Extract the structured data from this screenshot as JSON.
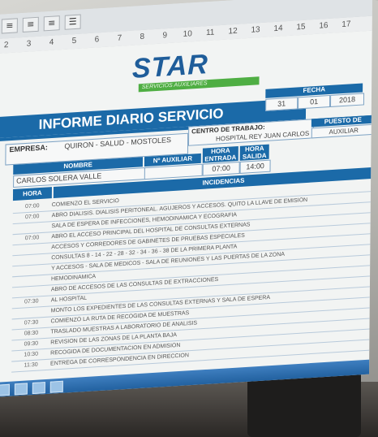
{
  "toolbar": {
    "icons": [
      "align-left-icon",
      "align-center-icon",
      "align-right-icon",
      "list-icon"
    ]
  },
  "ruler": [
    "2",
    "3",
    "4",
    "5",
    "6",
    "7",
    "8",
    "9",
    "10",
    "11",
    "12",
    "13",
    "14",
    "15",
    "16",
    "17"
  ],
  "logo": {
    "name": "STAR",
    "subtitle": "SERVICIOS AUXILIARES"
  },
  "report": {
    "title": "INFORME DIARIO SERVICIO",
    "fecha_label": "FECHA",
    "fecha": [
      "31",
      "01",
      "2018"
    ],
    "empresa_label": "EMPRESA:",
    "empresa": "QUIRON - SALUD - MOSTOLES",
    "centro_label": "CENTRO DE TRABAJO:",
    "centro": "HOSPITAL REY JUAN CARLOS",
    "puesto_label": "PUESTO DE TRABAJO",
    "puesto": "AUXILIAR",
    "nombre_label": "NOMBRE",
    "nauxiliar_label": "Nº AUXILIAR",
    "entrada_label": "HORA ENTRADA",
    "salida_label": "HORA SALIDA",
    "nombre": "CARLOS SOLERA VALLE",
    "entrada": "07:00",
    "salida": "14:00",
    "hora_label": "HORA",
    "incidencias_label": "INCIDENCIAS",
    "rows": [
      {
        "time": "07:00",
        "text": "COMIENZO EL SERVICIO"
      },
      {
        "time": "07:00",
        "text": "ABRO DIALISIS. DIALISIS PERITONEAL. AGUJEROS Y ACCESOS. QUITO LA LLAVE DE EMISION"
      },
      {
        "time": "",
        "text": "SALA DE ESPERA DE INFECCIONES, HEMODINAMICA Y ECOGRAFIA"
      },
      {
        "time": "07:00",
        "text": "ABRO EL ACCESO PRINCIPAL DEL HOSPITAL DE CONSULTAS EXTERNAS"
      },
      {
        "time": "",
        "text": "ACCESOS Y CORREDORES DE GABINETES DE PRUEBAS ESPECIALES"
      },
      {
        "time": "",
        "text": "CONSULTAS 8 - 14 - 22 - 28 - 32 - 34 - 36 - 38 DE LA PRIMERA PLANTA"
      },
      {
        "time": "",
        "text": "Y ACCESOS - SALA DE MEDICOS - SALA DE REUNIONES Y LAS PUERTAS DE LA ZONA"
      },
      {
        "time": "",
        "text": "HEMODINAMICA"
      },
      {
        "time": "",
        "text": "ABRO DE ACCESOS DE LAS CONSULTAS DE EXTRACCIONES"
      },
      {
        "time": "07:30",
        "text": "AL HOSPITAL"
      },
      {
        "time": "",
        "text": "MONTO LOS EXPEDIENTES DE LAS CONSULTAS EXTERNAS Y SALA DE ESPERA"
      },
      {
        "time": "07:30",
        "text": "COMIENZO LA RUTA DE RECOGIDA DE MUESTRAS"
      },
      {
        "time": "08:30",
        "text": "TRASLADO MUESTRAS A LABORATORIO DE ANALISIS"
      },
      {
        "time": "09:30",
        "text": "REVISION DE LAS ZONAS DE LA PLANTA BAJA"
      },
      {
        "time": "10:30",
        "text": "RECOGIDA DE DOCUMENTACION EN ADMISION"
      },
      {
        "time": "11:30",
        "text": "ENTREGA DE CORRESPONDENCIA EN DIRECCION"
      }
    ]
  }
}
